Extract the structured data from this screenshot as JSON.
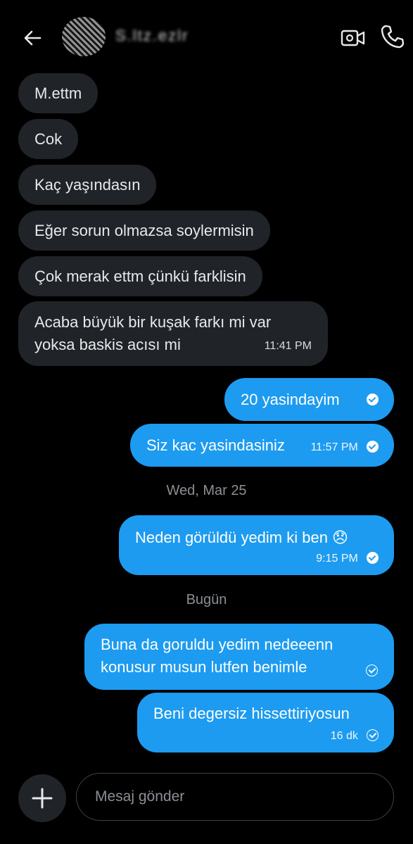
{
  "header": {
    "contact_name": "S.ltz.ezlr",
    "back_icon": "arrow-left-icon",
    "video_icon": "video-camera-icon",
    "call_icon": "phone-icon"
  },
  "messages_in": [
    {
      "text": "M.ettm"
    },
    {
      "text": "Cok"
    },
    {
      "text": "Kaç yaşındasın"
    },
    {
      "text": "Eğer sorun olmazsa soylermisin"
    },
    {
      "text": "Çok merak ettm çünkü farklisin"
    },
    {
      "line1": "Acaba büyük bir kuşak farkı mi var",
      "line2": "yoksa baskis acısı mi",
      "time": "11:41 PM"
    }
  ],
  "messages_out": [
    {
      "text": "20 yasindayim"
    },
    {
      "text": "Siz kac yasindasiniz",
      "time": "11:57 PM"
    },
    {
      "text": "Neden görüldü yedim ki ben 😞",
      "time": "9:15 PM"
    },
    {
      "line1": "Buna da goruldu yedim nedeeenn",
      "line2": "konusur musun lutfen benimle"
    },
    {
      "text": "Beni degersiz hissettiriyosun",
      "time": "16 dk"
    }
  ],
  "date_separators": [
    "Wed, Mar 25",
    "Bugün"
  ],
  "composer": {
    "placeholder": "Mesaj gönder",
    "add_icon": "plus-icon"
  },
  "colors": {
    "background": "#000000",
    "incoming_bubble": "#202327",
    "outgoing_bubble": "#1d9bf0",
    "muted_text": "#8b8f94"
  }
}
